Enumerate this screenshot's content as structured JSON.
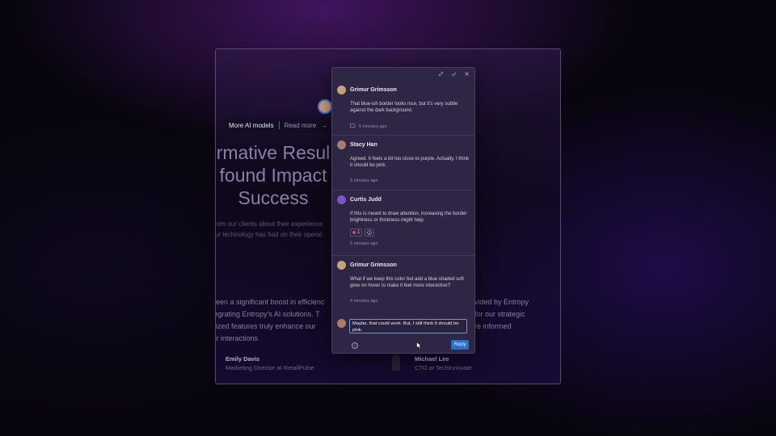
{
  "background_page": {
    "pill": {
      "label": "More AI models",
      "link": "Read more",
      "arrow": "→"
    },
    "headline": [
      "rmative Resul",
      "found Impact",
      "Success"
    ],
    "lead": [
      "y from our clients about their experience",
      "t our technology has had on their operat"
    ],
    "quote_left": [
      "e seen a significant boost in efficienc",
      " integrating Entropy's AI solutions. T",
      "nalized features truly enhance our",
      "mer interactions"
    ],
    "quote_right": [
      "vided by Entropy",
      "for our strategic",
      "re informed"
    ],
    "author_left": {
      "name": "Emily Davis",
      "role": "Marketing Director at RetailPulse"
    },
    "author_right": {
      "name": "Michael Lee",
      "role": "CTO at TechInnovate"
    }
  },
  "panel": {
    "toolbar": {
      "link_icon": "link-icon",
      "resolve_icon": "check-icon",
      "close_icon": "close-icon"
    },
    "comments": [
      {
        "author": "Grimur Grimsson",
        "text": "That blue-ish border looks nice, but it's very subtle against the dark background.",
        "time": "5 minutes ago",
        "avatar_color": "#c7a07c"
      },
      {
        "author": "Stacy Han",
        "text": "Agreed. It feels a bit too close to purple. Actually, I think it should be pink.",
        "time": "5 minutes ago",
        "avatar_color": "#a77d6b"
      },
      {
        "author": "Curtis Judd",
        "text": "If this is meant to draw attention, increasing the border brightness or thickness might help.",
        "reaction_count": "1",
        "time": "5 minutes ago",
        "avatar_color": "#7b54c8"
      },
      {
        "author": "Grimur Grimsson",
        "text": "What if we keep this color but add a blue shaded soft glow on hover to make it feel more interactive?",
        "time": "4 minutes ago",
        "avatar_color": "#c7a07c"
      }
    ],
    "reply": {
      "value": "Maybe, that could work. But, I still think it should be pink.",
      "button": "Reply"
    }
  }
}
